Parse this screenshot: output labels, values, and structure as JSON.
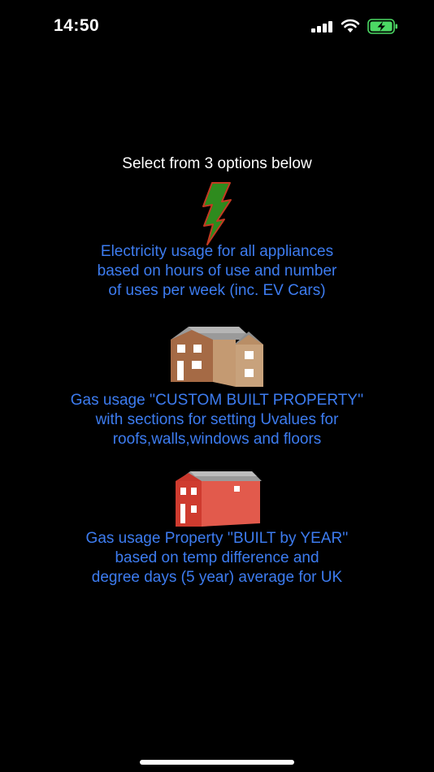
{
  "status_bar": {
    "time": "14:50",
    "icons": [
      "cellular-signal-icon",
      "wifi-icon",
      "battery-charging-icon"
    ],
    "battery_color": "#4cd964"
  },
  "prompt": "Select from 3 options below",
  "options": [
    {
      "icon": "lightning-bolt-icon",
      "text": "Electricity usage for all appliances\nbased on hours of use and number\nof uses per week (inc. EV Cars)"
    },
    {
      "icon": "brown-house-icon",
      "text": "Gas usage ''CUSTOM BUILT PROPERTY''\nwith sections for setting Uvalues for\nroofs,walls,windows and floors"
    },
    {
      "icon": "red-house-icon",
      "text": "Gas usage Property ''BUILT by YEAR''\nbased on temp difference and\ndegree days (5 year) average for UK"
    }
  ],
  "colors": {
    "background": "#000000",
    "option_text": "#3d7cf0",
    "prompt_text": "#ffffff"
  }
}
